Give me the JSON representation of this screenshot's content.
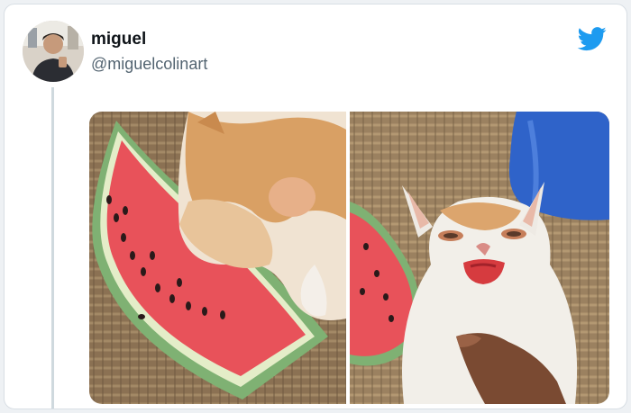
{
  "tweet": {
    "author_name": "miguel",
    "author_handle": "@miguelcolinart"
  },
  "icons": {
    "brand": "twitter-bird-icon",
    "brand_color": "#1d9bf0"
  },
  "media": {
    "photo_count": 2
  }
}
